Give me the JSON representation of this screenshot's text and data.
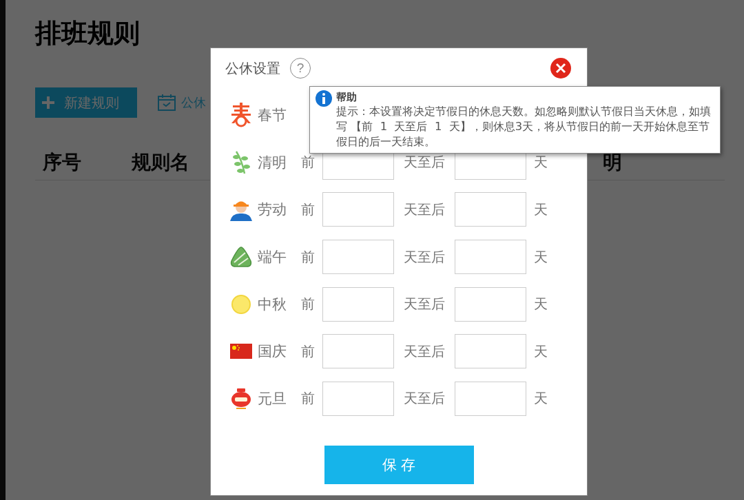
{
  "page": {
    "title": "排班规则",
    "new_button": "新建规则",
    "holiday_link": "公休",
    "columns": [
      "序号",
      "规则名",
      "明"
    ]
  },
  "dialog": {
    "title": "公休设置",
    "help_button": "?",
    "save_button": "保 存",
    "holidays": [
      {
        "name": "春节"
      },
      {
        "name": "清明",
        "before": "前",
        "between": "天至后",
        "after": "天"
      },
      {
        "name": "劳动",
        "before": "前",
        "between": "天至后",
        "after": "天"
      },
      {
        "name": "端午",
        "before": "前",
        "between": "天至后",
        "after": "天"
      },
      {
        "name": "中秋",
        "before": "前",
        "between": "天至后",
        "after": "天"
      },
      {
        "name": "国庆",
        "before": "前",
        "between": "天至后",
        "after": "天"
      },
      {
        "name": "元旦",
        "before": "前",
        "between": "天至后",
        "after": "天"
      }
    ]
  },
  "tooltip": {
    "title": "帮助",
    "text": "提示：本设置将决定节假日的休息天数。如忽略则默认节假日当天休息，如填写 【前  1  天至后  1  天】，则休息3天，将从节假日的前一天开始休息至节假日的后一天结束。"
  }
}
